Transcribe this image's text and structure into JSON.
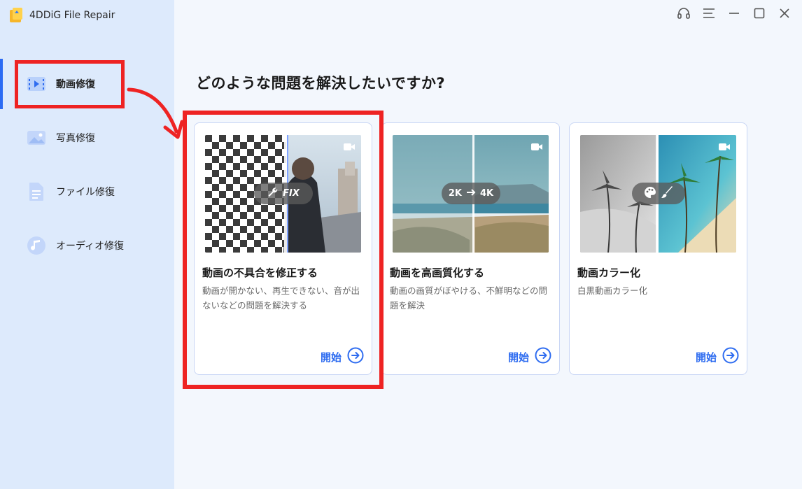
{
  "app": {
    "title": "4DDiG File Repair"
  },
  "sidebar": {
    "items": [
      {
        "label": "動画修復",
        "icon": "video-play-icon",
        "active": true
      },
      {
        "label": "写真修復",
        "icon": "image-icon",
        "active": false
      },
      {
        "label": "ファイル修復",
        "icon": "document-icon",
        "active": false
      },
      {
        "label": "オーディオ修復",
        "icon": "music-note-icon",
        "active": false
      }
    ]
  },
  "window_controls": [
    "headset-icon",
    "menu-icon",
    "minimize-icon",
    "maximize-icon",
    "close-icon"
  ],
  "main": {
    "heading": "どのような問題を解決したいですか?",
    "cards": [
      {
        "title": "動画の不具合を修正する",
        "description": "動画が開かない、再生できない、音が出ないなどの問題を解決する",
        "badge": "FIX",
        "start_label": "開始"
      },
      {
        "title": "動画を高画質化する",
        "description": "動画の画質がぼやける、不鮮明などの問題を解決",
        "badge_from": "2K",
        "badge_to": "4K",
        "start_label": "開始"
      },
      {
        "title": "動画カラー化",
        "description": "白黒動画カラー化",
        "start_label": "開始"
      }
    ]
  },
  "colors": {
    "accent": "#2e6cf0",
    "highlight": "#ee2323",
    "sidebar_bg": "#ddeafc",
    "main_bg": "#f3f7fd"
  }
}
